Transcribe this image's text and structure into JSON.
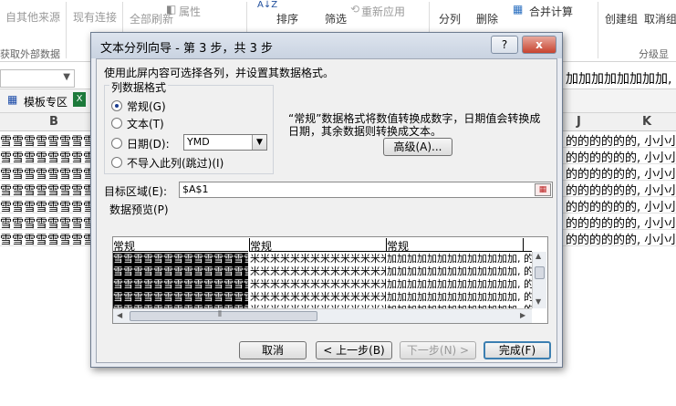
{
  "ribbon": {
    "items": [
      {
        "label": "自其他来源",
        "dim": true
      },
      {
        "label": "现有连接",
        "dim": true
      },
      {
        "label": "全部刷新",
        "dim": true
      },
      {
        "label": "属性",
        "dim": true
      },
      {
        "label": "排序",
        "dim": false
      },
      {
        "label": "筛选",
        "dim": false
      },
      {
        "label": "重新应用",
        "dim": true
      },
      {
        "label": "分列",
        "dim": false
      },
      {
        "label": "删除",
        "dim": false
      },
      {
        "label": "合并计算",
        "dim": false
      },
      {
        "label": "创建组",
        "dim": false
      },
      {
        "label": "取消组",
        "dim": false
      }
    ],
    "group_external": "获取外部数据",
    "group_outline": "分级显"
  },
  "formula_bar": {
    "content": "加加加加加加加加, 的"
  },
  "sheet_tab": {
    "label": "模板专区"
  },
  "columns": {
    "b": "B",
    "j": "J",
    "k": "K"
  },
  "grid": {
    "left_text": "雪雪雪雪雪雪雪雪雪",
    "right_text": "的的的的的的, 小小小",
    "rows": [
      0,
      1,
      2,
      3,
      4,
      5,
      6
    ]
  },
  "dialog": {
    "title": "文本分列向导 - 第 3 步，共 3 步",
    "help": "?",
    "close": "x",
    "instruction": "使用此屏内容可选择各列，并设置其数据格式。",
    "format_group": "列数据格式",
    "options": {
      "general": "常规(G)",
      "text": "文本(T)",
      "date": "日期(D):",
      "skip": "不导入此列(跳过)(I)"
    },
    "date_format": "YMD",
    "description_line1": "“常规”数据格式将数值转换成数字，日期值会转换成",
    "description_line2": "日期，其余数据则转换成文本。",
    "advanced_button": "高级(A)...",
    "destination_label": "目标区域(E):",
    "destination_value": "$A$1",
    "preview_label": "数据预览(P)",
    "preview": {
      "headers": [
        "常规",
        "常规",
        "常规"
      ],
      "col1": "雪雪雪雪雪雪雪雪雪雪雪雪雪雪雪",
      "col2": "米米米米米米米米米米米米米米米,",
      "col3": "加加加加加加加加加加加加加, 的",
      "rows": [
        0,
        1,
        2,
        3,
        4
      ]
    },
    "buttons": {
      "cancel": "取消",
      "back": "< 上一步(B)",
      "next": "下一步(N) >",
      "finish": "完成(F)"
    }
  }
}
